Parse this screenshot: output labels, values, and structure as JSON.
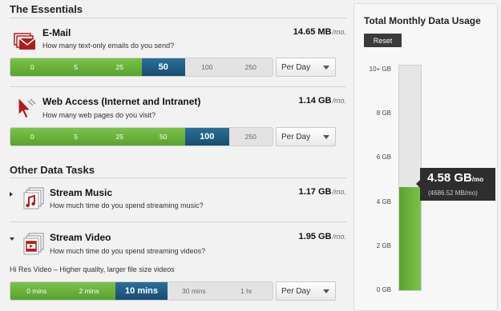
{
  "essentials": {
    "title": "The Essentials",
    "email": {
      "title": "E-Mail",
      "question": "How many text-only emails do you send?",
      "amount": "14.65 MB",
      "unit": "/mo.",
      "slider": [
        "0",
        "5",
        "25",
        "50",
        "100",
        "250"
      ],
      "selected_index": 3,
      "period": "Per Day",
      "icon": "email-icon"
    },
    "web": {
      "title": "Web Access (Internet and Intranet)",
      "question": "How many web pages do you visit?",
      "amount": "1.14 GB",
      "unit": "/mo.",
      "slider": [
        "0",
        "5",
        "25",
        "50",
        "100",
        "250"
      ],
      "selected_index": 4,
      "period": "Per Day",
      "icon": "cursor-icon"
    }
  },
  "other": {
    "title": "Other Data Tasks",
    "music": {
      "title": "Stream Music",
      "question": "How much time do you spend streaming music?",
      "amount": "1.17 GB",
      "unit": "/mo.",
      "icon": "music-icon",
      "expander": "collapsed"
    },
    "video": {
      "title": "Stream Video",
      "question": "How much time do you spend streaming videos?",
      "amount": "1.95 GB",
      "unit": "/mo.",
      "icon": "video-icon",
      "expander": "expanded",
      "hires_label": "Hi Res Video – Higher quality, larger file size videos",
      "slider": [
        "0 mins",
        "2 mins",
        "10 mins",
        "30 mins",
        "1 hr"
      ],
      "selected_index": 2,
      "period": "Per Day"
    }
  },
  "panel": {
    "title": "Total Monthly Data Usage",
    "reset_label": "Reset",
    "axis": [
      "10+ GB",
      "8 GB",
      "6 GB",
      "4 GB",
      "2 GB",
      "0 GB"
    ],
    "total_value": "4.58 GB",
    "total_unit": "/mo",
    "total_sub": "(4686.52 MB/mo)",
    "fill_fraction": 0.458
  },
  "colors": {
    "green": "#58a22e",
    "blue": "#184d6e",
    "accent_red": "#b31b1b"
  }
}
